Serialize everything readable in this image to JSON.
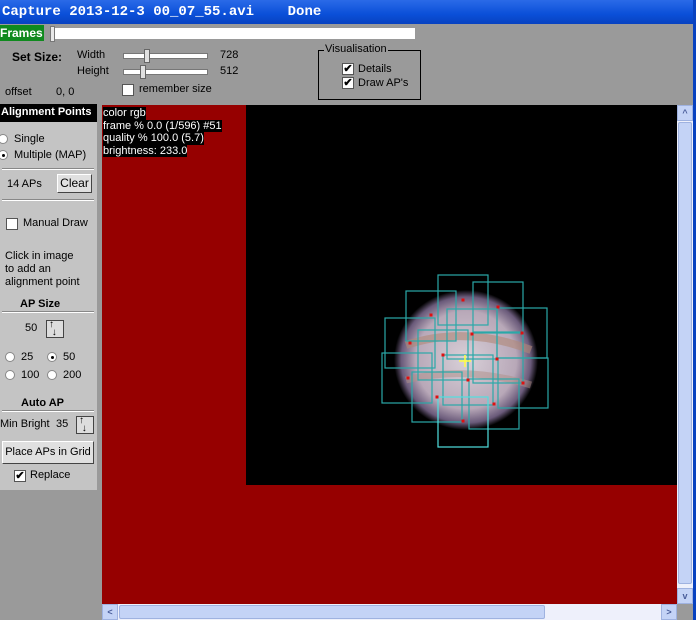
{
  "window": {
    "title": "Capture 2013-12-3 00_07_55.avi    Done"
  },
  "frames": {
    "label": "Frames",
    "position_fraction": 0.0
  },
  "set_size": {
    "label": "Set Size:",
    "width_label": "Width",
    "width_value": "728",
    "height_label": "Height",
    "height_value": "512",
    "remember_label": "remember size",
    "remember_checked": false,
    "offset_label": "offset",
    "offset_value": "0, 0"
  },
  "visualisation": {
    "title": "Visualisation",
    "details_label": "Details",
    "details_checked": true,
    "draw_aps_label": "Draw AP's",
    "draw_aps_checked": true
  },
  "alignment": {
    "title": "Alignment Points",
    "single_label": "Single",
    "multiple_label": "Multiple (MAP)",
    "mode": "multiple",
    "count_label": "14 APs",
    "clear_label": "Clear",
    "manual_draw_label": "Manual Draw",
    "manual_draw_checked": false,
    "help_lines": [
      "Click in image",
      "to add an",
      "alignment point"
    ]
  },
  "ap_size": {
    "title": "AP Size",
    "value": "50",
    "options": [
      "25",
      "50",
      "100",
      "200"
    ],
    "selected": "50"
  },
  "auto_ap": {
    "title": "Auto AP",
    "min_bright_label": "Min Bright",
    "min_bright_value": "35",
    "place_label": "Place APs in Grid",
    "replace_label": "Replace",
    "replace_checked": true
  },
  "overlay": {
    "lines": [
      "color rgb",
      "frame % 0.0 (1/596) #51",
      "quality % 100.0  (5.7)",
      "brightness: 233.0"
    ]
  },
  "colors": {
    "background": "#960000",
    "ap_box": "#2aa8a8",
    "ap_point": "#e01010",
    "cursor": "#ffff40"
  }
}
